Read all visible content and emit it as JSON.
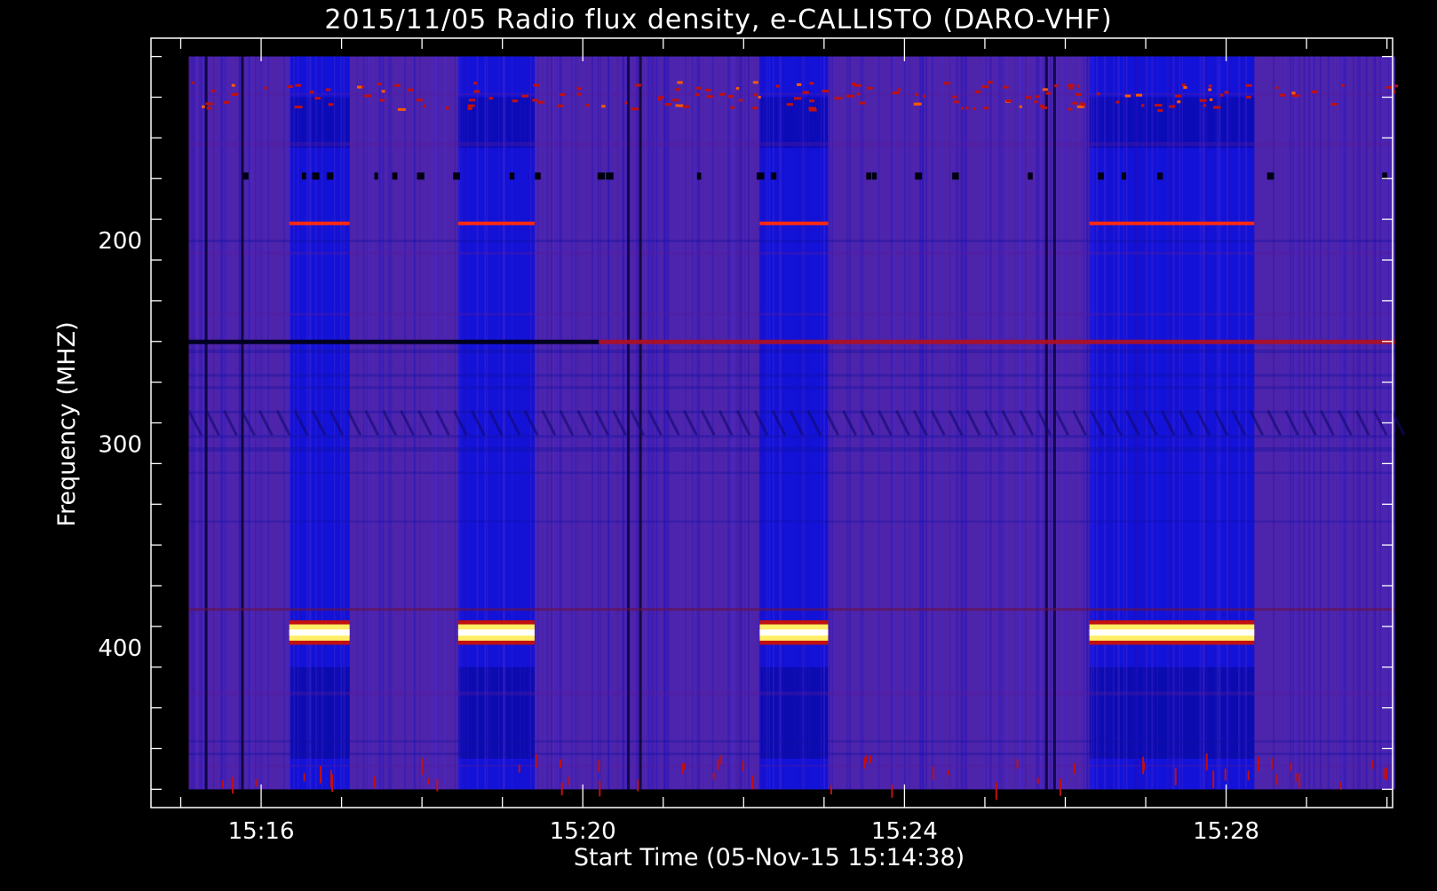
{
  "chart_data": {
    "type": "heatmap",
    "title": "2015/11/05  Radio flux density, e-CALLISTO (DARO-VHF)",
    "xlabel": "Start Time (05-Nov-15 15:14:38)",
    "ylabel": "Frequency (MHZ)",
    "x_range_minutes": [
      14.63,
      30.07
    ],
    "x_data_range_minutes": [
      15.1,
      30.1
    ],
    "xticks": [
      {
        "value": 16,
        "label": "15:16"
      },
      {
        "value": 20,
        "label": "15:20"
      },
      {
        "value": 24,
        "label": "15:24"
      },
      {
        "value": 28,
        "label": "15:28"
      }
    ],
    "y_range_mhz": [
      101,
      479
    ],
    "y_data_range_mhz": [
      110,
      470
    ],
    "yticks": [
      {
        "value": 200,
        "label": "200"
      },
      {
        "value": 300,
        "label": "300"
      },
      {
        "value": 400,
        "label": "400"
      }
    ],
    "colormap": [
      "#000000",
      "#1a1aff",
      "#3a22c8",
      "#6a1f7e",
      "#c01010",
      "#ff5a00",
      "#ffee66",
      "#ffffff"
    ],
    "background_color": "#2a2adf",
    "quiet_blocks": [
      {
        "start": 16.35,
        "end": 17.1
      },
      {
        "start": 18.45,
        "end": 19.4
      },
      {
        "start": 22.2,
        "end": 23.05
      },
      {
        "start": 26.3,
        "end": 28.35
      }
    ],
    "bright_band_mhz": [
      389,
      397
    ],
    "red_line_mhz": 192,
    "interference_line_mhz": 250
  }
}
